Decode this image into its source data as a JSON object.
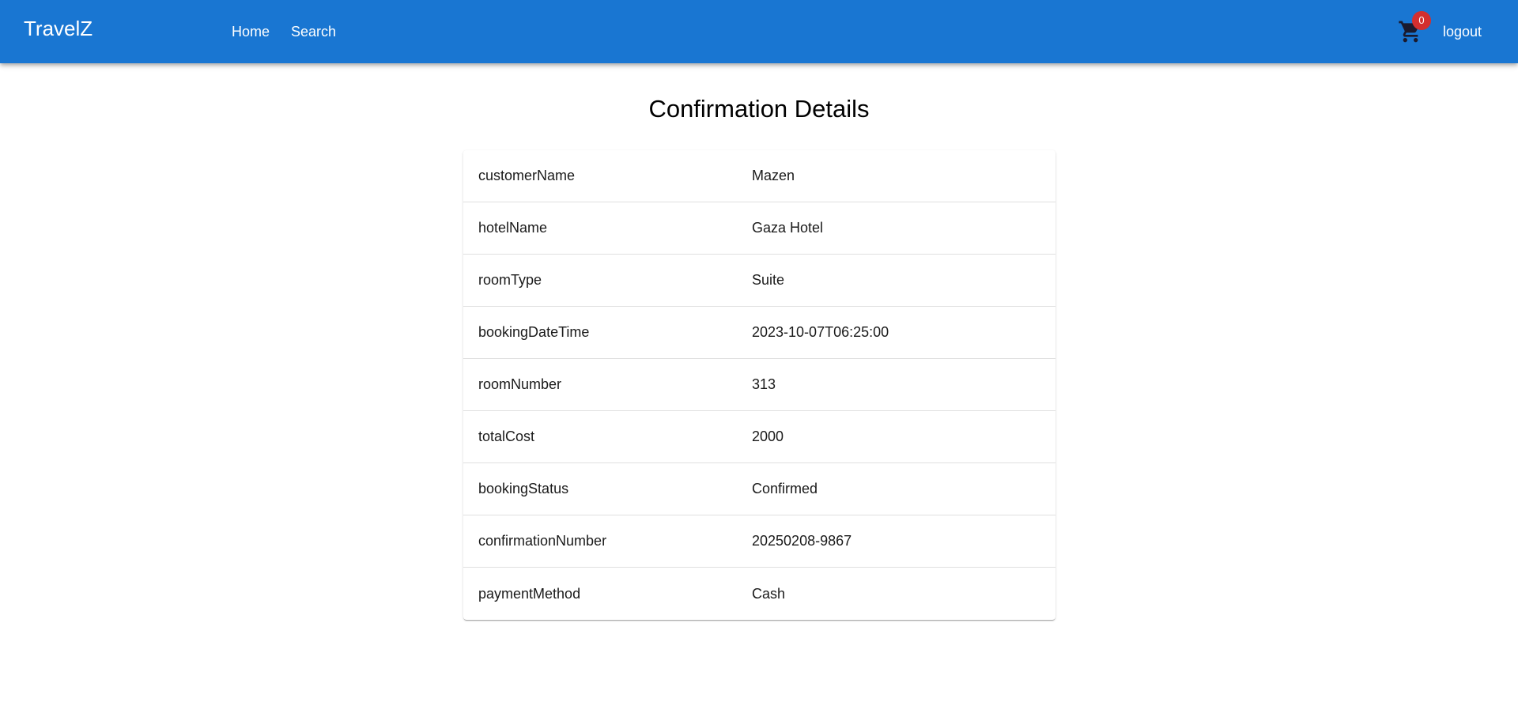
{
  "header": {
    "brand": "TravelZ",
    "nav": [
      {
        "label": "Home"
      },
      {
        "label": "Search"
      }
    ],
    "cart_count": "0",
    "cart_icon": "shopping-cart-icon",
    "logout_label": "logout",
    "bar_color": "#1976d2",
    "badge_color": "#d32f2f"
  },
  "main": {
    "title": "Confirmation Details",
    "rows": [
      {
        "key": "customerName",
        "value": "Mazen"
      },
      {
        "key": "hotelName",
        "value": "Gaza Hotel"
      },
      {
        "key": "roomType",
        "value": "Suite"
      },
      {
        "key": "bookingDateTime",
        "value": "2023-10-07T06:25:00"
      },
      {
        "key": "roomNumber",
        "value": "313"
      },
      {
        "key": "totalCost",
        "value": "2000"
      },
      {
        "key": "bookingStatus",
        "value": "Confirmed"
      },
      {
        "key": "confirmationNumber",
        "value": "20250208-9867"
      },
      {
        "key": "paymentMethod",
        "value": "Cash"
      }
    ]
  }
}
